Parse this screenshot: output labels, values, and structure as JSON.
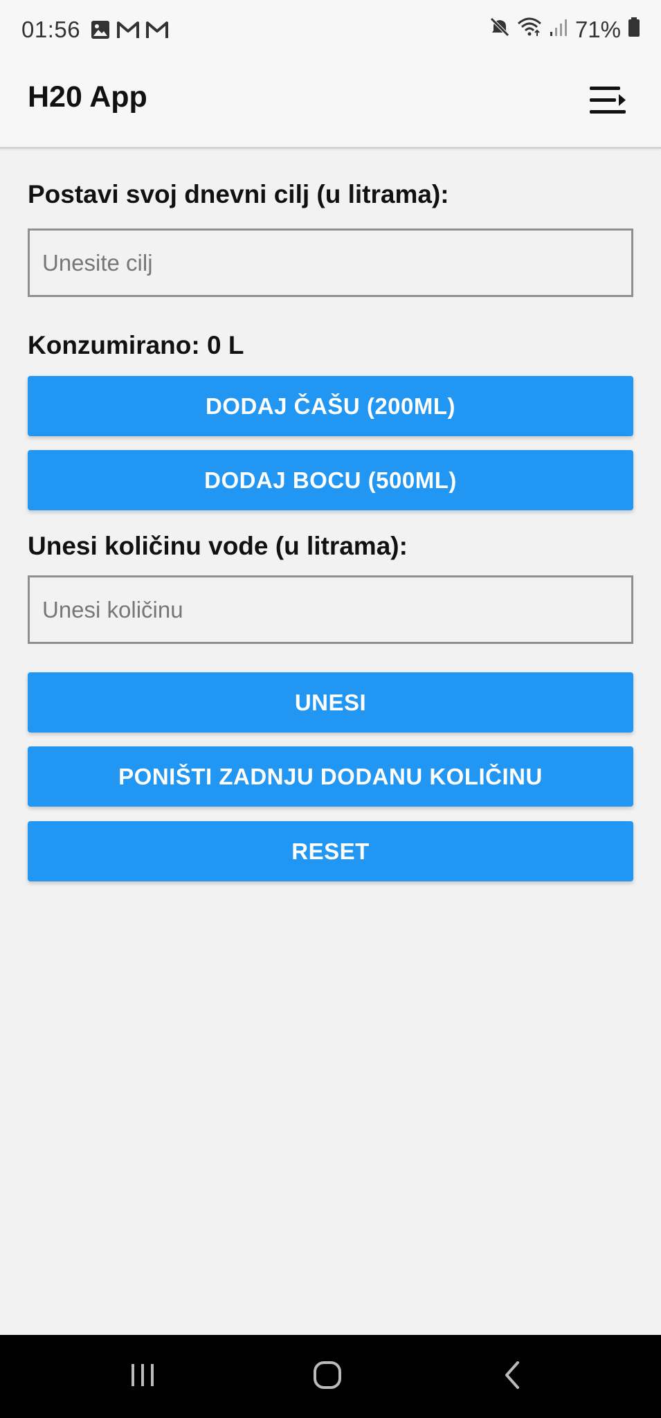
{
  "status_bar": {
    "time": "01:56",
    "battery_percent": "71%",
    "left_icons": [
      "gallery-icon",
      "gmail-icon",
      "gmail-icon"
    ],
    "right_icons": [
      "mute-icon",
      "wifi-icon",
      "signal-icon",
      "battery-icon"
    ]
  },
  "app_bar": {
    "title": "H20 App",
    "menu_icon": "menu-icon"
  },
  "goal": {
    "label": "Postavi svoj dnevni cilj (u litrama):",
    "placeholder": "Unesite cilj",
    "value": ""
  },
  "consumed": {
    "text": "Konzumirano: 0 L"
  },
  "buttons": {
    "add_glass": "DODAJ ČAŠU (200ML)",
    "add_bottle": "DODAJ BOCU (500ML)",
    "enter": "UNESI",
    "undo": "PONIŠTI ZADNJU DODANU KOLIČINU",
    "reset": "RESET"
  },
  "amount": {
    "label": "Unesi količinu vode (u litrama):",
    "placeholder": "Unesi količinu",
    "value": ""
  },
  "nav_bar": {
    "icons": [
      "recent-apps-icon",
      "home-icon",
      "back-icon"
    ]
  },
  "colors": {
    "accent": "#2196f3",
    "background": "#f2f2f3",
    "app_bar": "#f7f7f7",
    "nav_bar": "#000000"
  }
}
